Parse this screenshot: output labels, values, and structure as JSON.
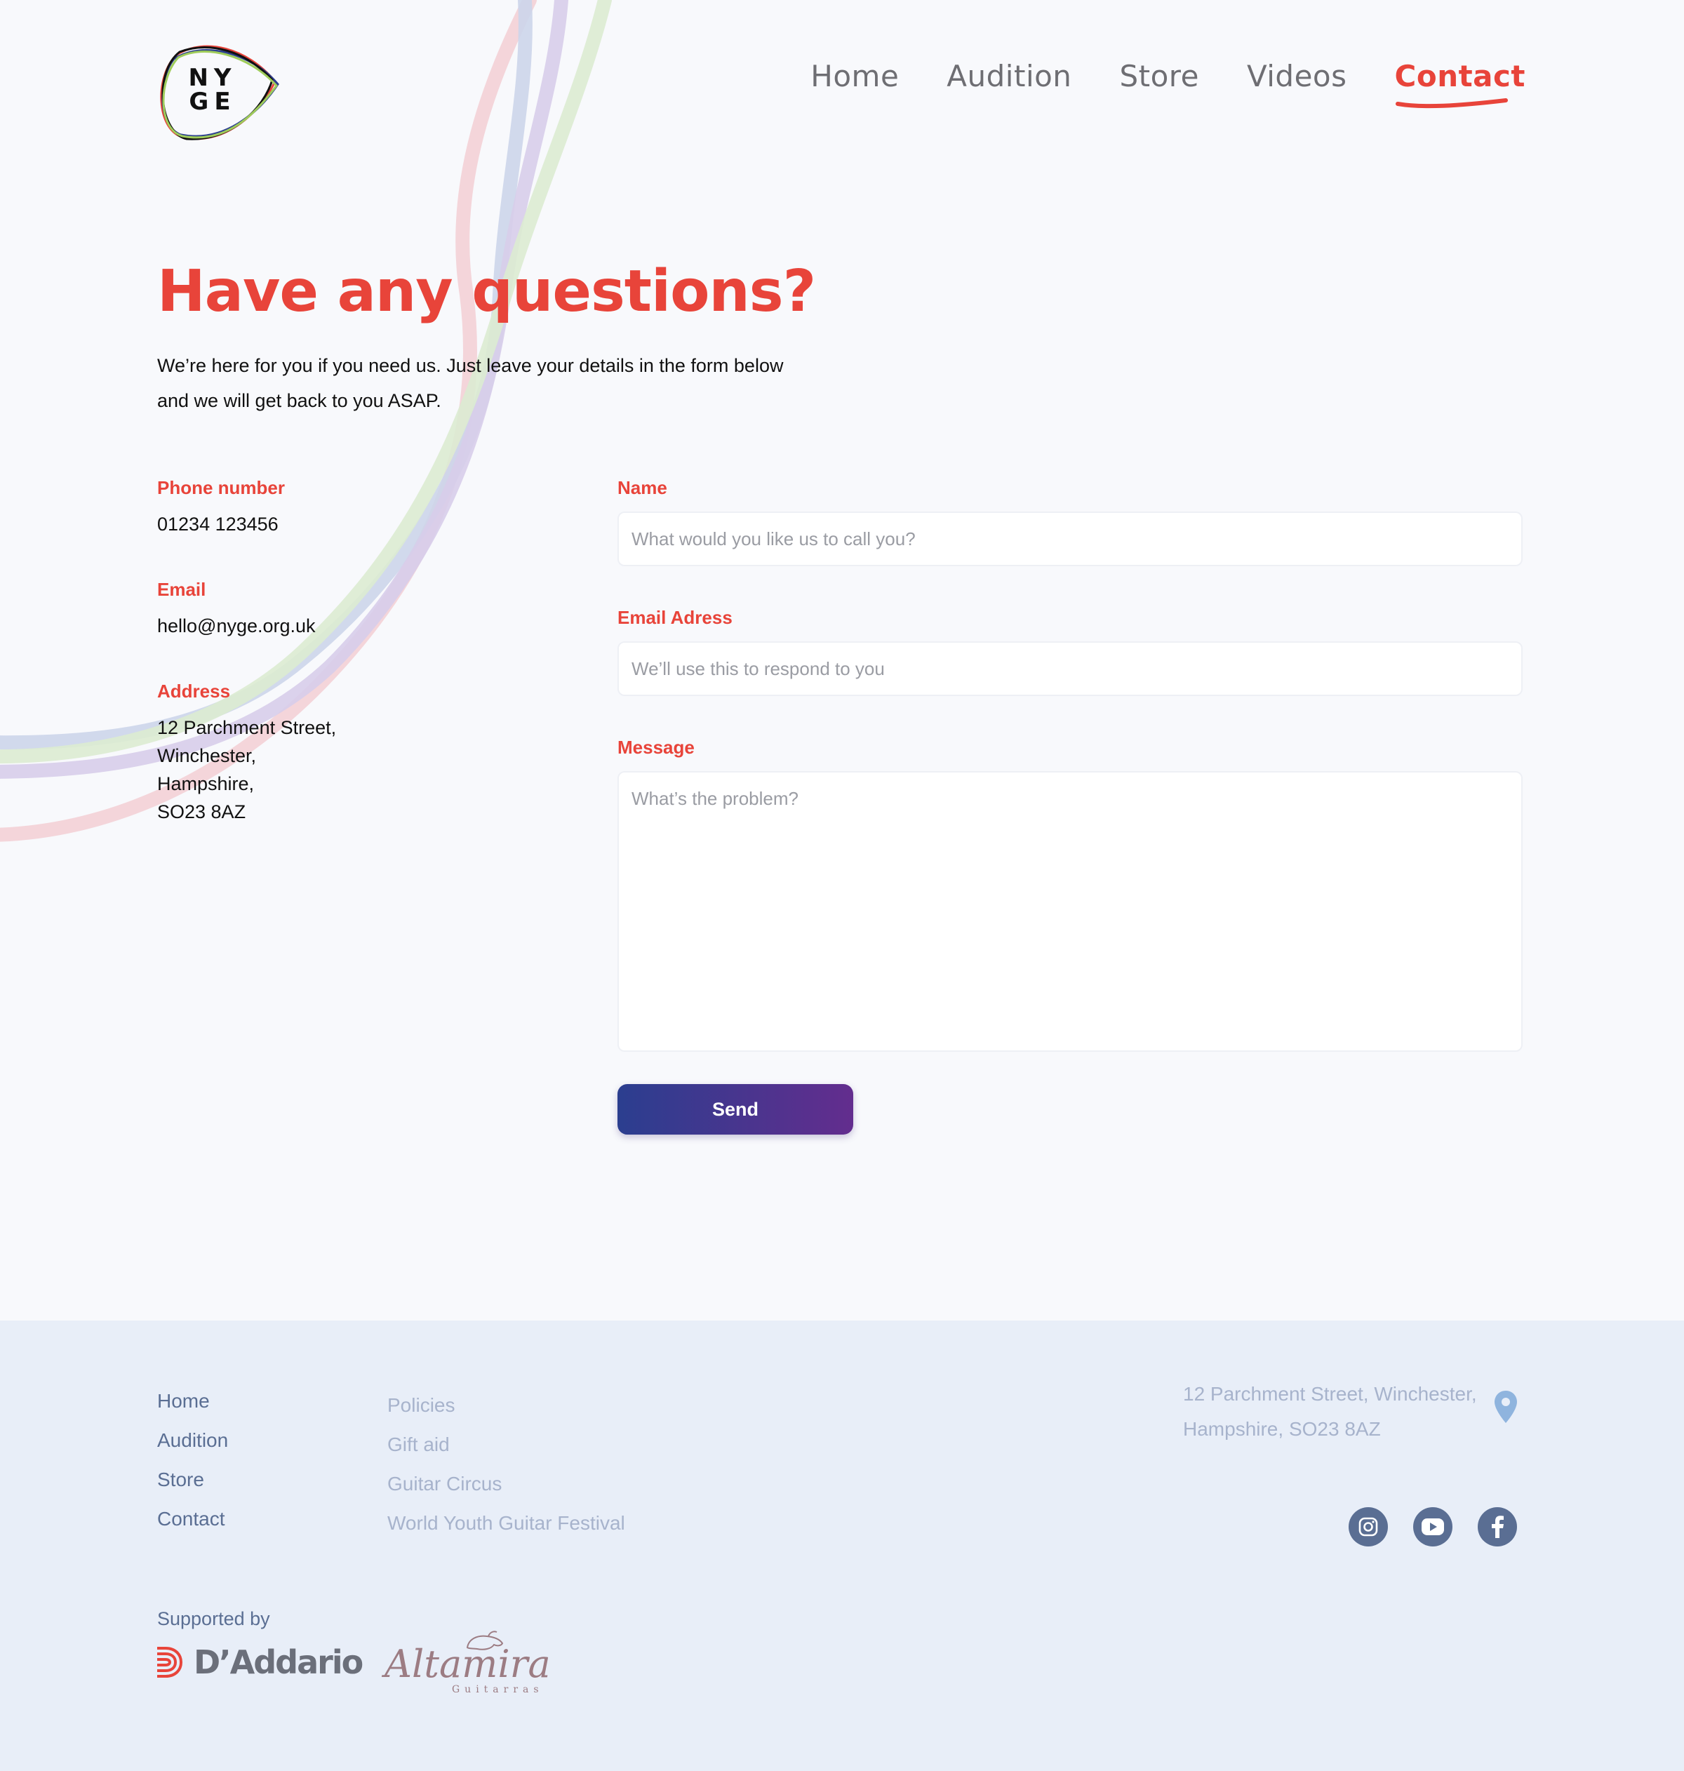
{
  "brand": {
    "logo_text": "NY GE"
  },
  "nav": {
    "items": [
      {
        "label": "Home"
      },
      {
        "label": "Audition"
      },
      {
        "label": "Store"
      },
      {
        "label": "Videos"
      },
      {
        "label": "Contact",
        "active": true
      }
    ],
    "active_color": "#e8443a"
  },
  "hero": {
    "title": "Have any questions?",
    "subtitle_line1": "We’re here for you if you need us. Just leave your details in the form below",
    "subtitle_line2": "and we will get back to you ASAP."
  },
  "contact": {
    "phone_label": "Phone number",
    "phone": "01234 123456",
    "email_label": "Email",
    "email": "hello@nyge.org.uk",
    "address_label": "Address",
    "address_lines": [
      "12 Parchment Street,",
      "Winchester,",
      "Hampshire,",
      "SO23 8AZ"
    ]
  },
  "form": {
    "name_label": "Name",
    "name_placeholder": "What would you like us to call you?",
    "email_label": "Email Adress",
    "email_placeholder": "We’ll use this to respond to you",
    "message_label": "Message",
    "message_placeholder": "What’s the problem?",
    "send_label": "Send"
  },
  "footer": {
    "nav_links": [
      "Home",
      "Audition",
      "Store",
      "Contact"
    ],
    "secondary_links": [
      "Policies",
      "Gift aid",
      "Guitar Circus",
      "World Youth Guitar Festival"
    ],
    "address_line1": "12 Parchment Street, Winchester,",
    "address_line2": "Hampshire, SO23 8AZ",
    "social": [
      "instagram-icon",
      "youtube-icon",
      "facebook-icon"
    ],
    "supported_by": "Supported by",
    "sponsors": [
      "D’Addario",
      "Altamira",
      "Guitarras"
    ]
  },
  "colors": {
    "accent": "#e8443a",
    "button_gradient_start": "#2b3e8f",
    "button_gradient_end": "#632d8e",
    "footer_bg": "#e8eef8",
    "footer_link": "#5a6e93",
    "footer_muted": "#a7b3cc"
  }
}
